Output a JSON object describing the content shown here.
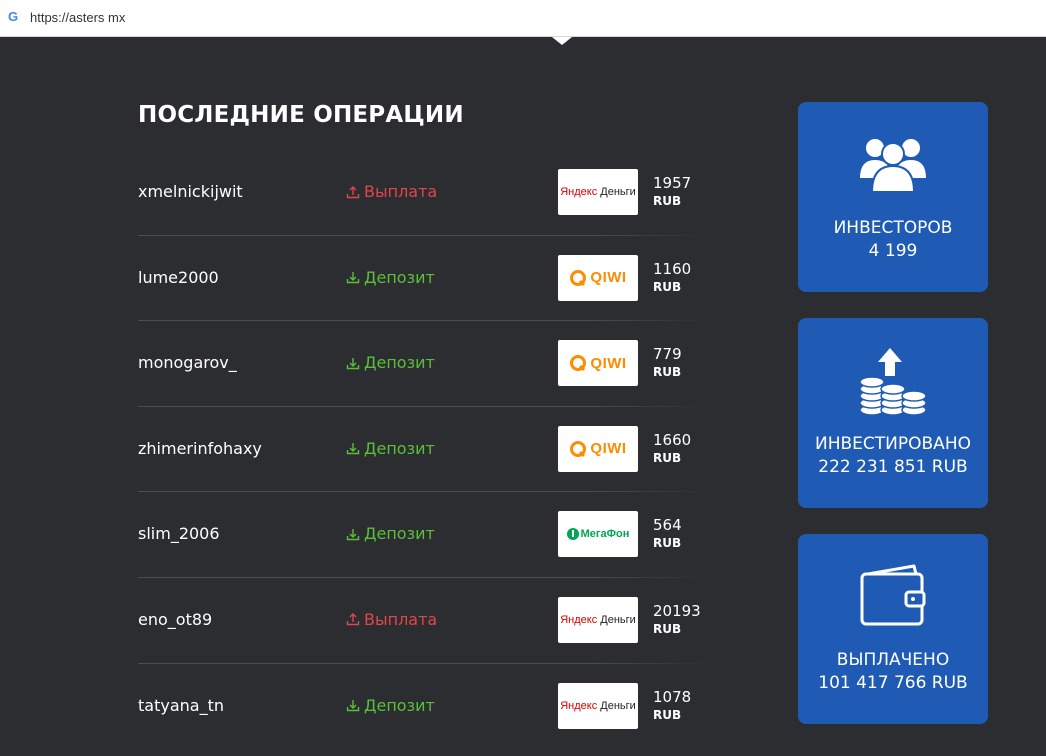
{
  "browser": {
    "url": "https://asters mx",
    "icon": "google-g-icon"
  },
  "section": {
    "title": "ПОСЛЕДНИЕ ОПЕРАЦИИ"
  },
  "colors": {
    "payout": "#e2454b",
    "deposit": "#5bbf3a",
    "card": "#1f5bb5",
    "background": "#2b2d31"
  },
  "operations": [
    {
      "user": "xmelnickijwit",
      "type": "Выплата",
      "kind": "payout",
      "method": "yandex",
      "amount": "1957",
      "currency": "RUB"
    },
    {
      "user": "lume2000",
      "type": "Депозит",
      "kind": "deposit",
      "method": "qiwi",
      "amount": "1160",
      "currency": "RUB"
    },
    {
      "user": "monogarov_",
      "type": "Депозит",
      "kind": "deposit",
      "method": "qiwi",
      "amount": "779",
      "currency": "RUB"
    },
    {
      "user": "zhimerinfohaxy",
      "type": "Депозит",
      "kind": "deposit",
      "method": "qiwi",
      "amount": "1660",
      "currency": "RUB"
    },
    {
      "user": "slim_2006",
      "type": "Депозит",
      "kind": "deposit",
      "method": "megafon",
      "amount": "564",
      "currency": "RUB"
    },
    {
      "user": "eno_ot89",
      "type": "Выплата",
      "kind": "payout",
      "method": "yandex",
      "amount": "20193",
      "currency": "RUB"
    },
    {
      "user": "tatyana_tn",
      "type": "Депозит",
      "kind": "deposit",
      "method": "yandex",
      "amount": "1078",
      "currency": "RUB"
    }
  ],
  "logos": {
    "yandex": {
      "part1": "Яндекс",
      "part2": " Деньги"
    },
    "qiwi": {
      "text": "QIWI"
    },
    "megafon": {
      "text": "МегаФон"
    }
  },
  "stats": [
    {
      "label": "ИНВЕСТОРОВ",
      "value": "4 199",
      "icon": "users-icon"
    },
    {
      "label": "ИНВЕСТИРОВАНО",
      "value": "222 231 851 RUB",
      "icon": "coins-icon"
    },
    {
      "label": "ВЫПЛАЧЕНО",
      "value": "101 417 766 RUB",
      "icon": "wallet-icon"
    }
  ]
}
